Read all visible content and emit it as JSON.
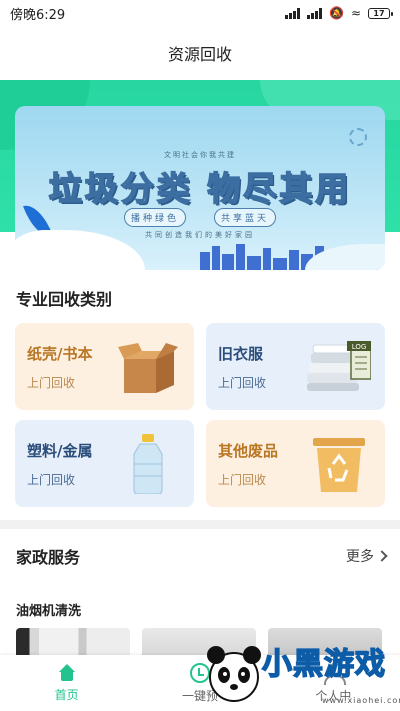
{
  "status_bar": {
    "time": "傍晚6:29",
    "battery": "17"
  },
  "header": {
    "title": "资源回收"
  },
  "banner": {
    "slogan_top": "文明社会你我共建",
    "headline": "垃圾分类 物尽其用",
    "pill_left": "播种绿色",
    "pill_right": "共享蓝天",
    "slogan_bottom": "共同创造我们的美好家园"
  },
  "categories_section": {
    "title": "专业回收类别",
    "items": [
      {
        "name": "纸壳/书本",
        "sub": "上门回收",
        "icon": "cardboard-box-icon"
      },
      {
        "name": "旧衣服",
        "sub": "上门回收",
        "icon": "folded-clothes-icon"
      },
      {
        "name": "塑料/金属",
        "sub": "上门回收",
        "icon": "plastic-bottle-icon"
      },
      {
        "name": "其他废品",
        "sub": "上门回收",
        "icon": "recycle-bin-icon"
      }
    ]
  },
  "home_service": {
    "title": "家政服务",
    "more": "更多",
    "first_service": "油烟机清洗"
  },
  "tabbar": {
    "items": [
      {
        "label": "首页"
      },
      {
        "label": "一键预"
      },
      {
        "label": "个人中"
      }
    ],
    "active": 0
  },
  "watermark": {
    "text": "小黑游戏",
    "url": "www.xiaohei.com"
  },
  "colors": {
    "accent": "#22c38e",
    "hero": "#2fe0a8",
    "warm_card": "#fdf0e1",
    "cool_card": "#e7f0fa"
  }
}
